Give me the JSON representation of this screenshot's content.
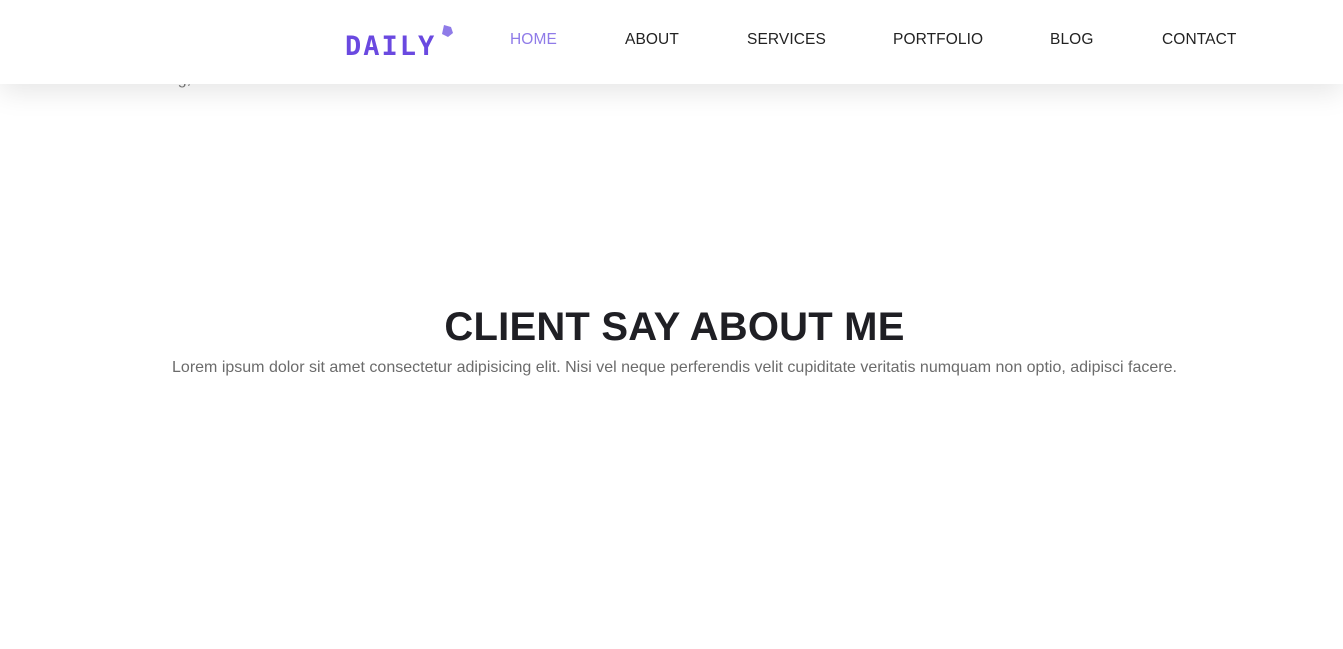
{
  "behind_header": {
    "text": "Following, Portfolio"
  },
  "header": {
    "logo_text": "DAILY",
    "colors": {
      "logo": "#6a49e0",
      "logo_dot": "#8f7be8",
      "active_link": "#8f7be8",
      "link": "#222222"
    },
    "nav": [
      {
        "label": "HOME",
        "active": true
      },
      {
        "label": "ABOUT",
        "active": false
      },
      {
        "label": "SERVICES",
        "active": false
      },
      {
        "label": "PORTFOLIO",
        "active": false
      },
      {
        "label": "BLOG",
        "active": false
      },
      {
        "label": "CONTACT",
        "active": false
      }
    ]
  },
  "testimonials": {
    "title": "CLIENT SAY ABOUT ME",
    "subtitle": "Lorem ipsum dolor sit amet consectetur adipisicing elit. Nisi vel neque perferendis velit cupiditate veritatis numquam non optio, adipisci facere."
  }
}
